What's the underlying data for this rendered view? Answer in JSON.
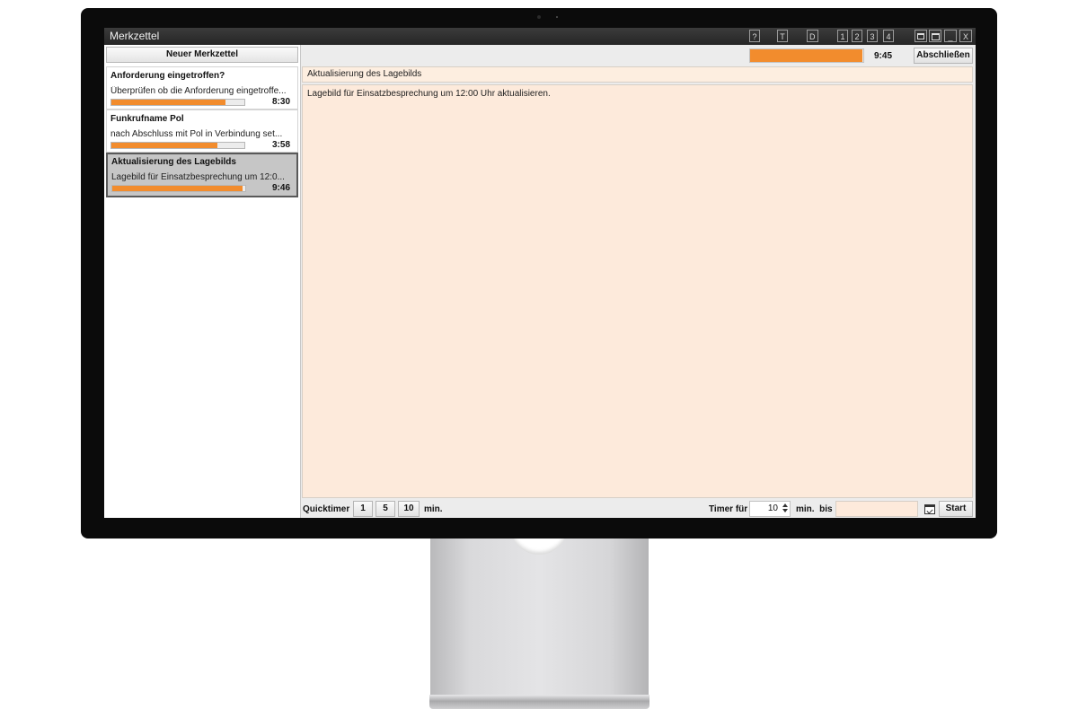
{
  "window": {
    "title": "Merkzettel",
    "buttons": {
      "help": "?",
      "t": "T",
      "d": "D",
      "screen1": "1",
      "screen2": "2",
      "screen3": "3",
      "screen4": "4",
      "minimize": "_",
      "close": "X"
    }
  },
  "sidebar": {
    "new_note_label": "Neuer Merkzettel",
    "notes": [
      {
        "title": "Anforderung eingetroffen?",
        "description": "Überprüfen ob die Anforderung eingetroffe...",
        "time": "8:30",
        "progress": 0.86
      },
      {
        "title": "Funkrufname Pol",
        "description": "nach Abschluss mit Pol in Verbindung set...",
        "time": "3:58",
        "progress": 0.8
      },
      {
        "title": "Aktualisierung des Lagebilds",
        "description": "Lagebild für Einsatzbesprechung um 12:0...",
        "time": "9:46",
        "progress": 0.98,
        "selected": true
      }
    ]
  },
  "main": {
    "time": "9:45",
    "progress": 0.99,
    "finish_label": "Abschließen",
    "subject": "Aktualisierung des Lagebilds",
    "body": "Lagebild für Einsatzbesprechung um 12:00 Uhr aktualisieren."
  },
  "bottom": {
    "quicktimer_label": "Quicktimer",
    "quick_buttons": [
      "1",
      "5",
      "10"
    ],
    "min_label": "min.",
    "timer_for_label": "Timer für",
    "timer_value": "10",
    "min_until_label": "min.  bis",
    "until_value": "",
    "start_label": "Start"
  },
  "colors": {
    "accent": "#f28c2d",
    "field_background": "#fdeadb",
    "selected_card": "#c6c6c6",
    "titlebar": "#2e2e2e"
  }
}
